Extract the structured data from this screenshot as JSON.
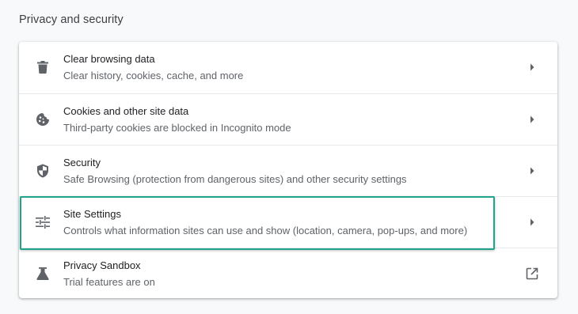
{
  "section": {
    "title": "Privacy and security"
  },
  "rows": [
    {
      "label": "Clear browsing data",
      "sublabel": "Clear history, cookies, cache, and more",
      "icon": "trash-icon",
      "trailing_icon": "chevron-right-icon"
    },
    {
      "label": "Cookies and other site data",
      "sublabel": "Third-party cookies are blocked in Incognito mode",
      "icon": "cookie-icon",
      "trailing_icon": "chevron-right-icon"
    },
    {
      "label": "Security",
      "sublabel": "Safe Browsing (protection from dangerous sites) and other security settings",
      "icon": "shield-icon",
      "trailing_icon": "chevron-right-icon"
    },
    {
      "label": "Site Settings",
      "sublabel": "Controls what information sites can use and show (location, camera, pop-ups, and more)",
      "icon": "tune-icon",
      "trailing_icon": "chevron-right-icon",
      "highlighted": true
    },
    {
      "label": "Privacy Sandbox",
      "sublabel": "Trial features are on",
      "icon": "flask-icon",
      "trailing_icon": "open-in-new-icon"
    }
  ],
  "colors": {
    "highlight_border": "#1fa38a",
    "icon": "#5f6368",
    "background": "#f8f9fa"
  }
}
